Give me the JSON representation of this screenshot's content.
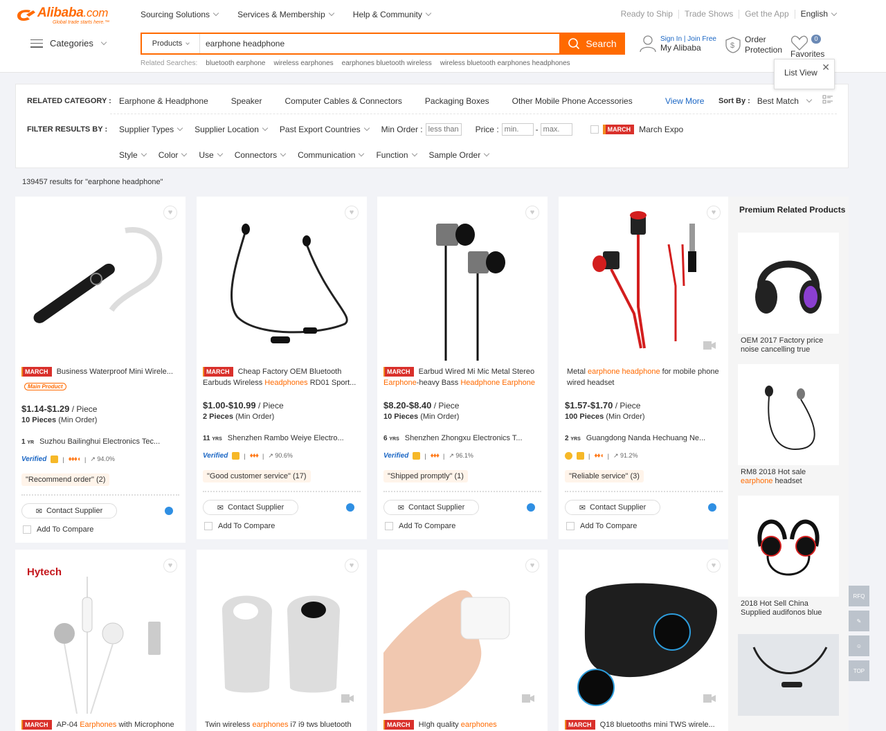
{
  "logo": {
    "brand": "Alibaba",
    "tld": ".com",
    "tagline": "Global trade starts here.™"
  },
  "topnav": [
    "Sourcing Solutions",
    "Services & Membership",
    "Help & Community"
  ],
  "topright": [
    "Ready to Ship",
    "Trade Shows",
    "Get the App",
    "English"
  ],
  "categories_label": "Categories",
  "search": {
    "type": "Products",
    "value": "earphone headphone",
    "button": "Search"
  },
  "related": {
    "label": "Related Searches:",
    "items": [
      "bluetooth earphone",
      "wireless earphones",
      "earphones bluetooth wireless",
      "wireless bluetooth earphones headphones"
    ]
  },
  "account": {
    "signin": "Sign In",
    "join": "Join Free",
    "my": "My Alibaba"
  },
  "order": {
    "line1": "Order",
    "line2": "Protection"
  },
  "favorites": {
    "label": "Favorites",
    "count": "0"
  },
  "listview": {
    "label": "List View"
  },
  "filter": {
    "related_label": "RELATED CATEGORY :",
    "related_items": [
      "Earphone & Headphone",
      "Speaker",
      "Computer Cables & Connectors",
      "Packaging Boxes",
      "Other Mobile Phone Accessories"
    ],
    "view_more": "View More",
    "sort_label": "Sort By :",
    "sort_value": "Best Match",
    "filter_label": "FILTER RESULTS BY :",
    "dropdowns1": [
      "Supplier Types",
      "Supplier Location",
      "Past Export Countries"
    ],
    "min_order_label": "Min Order :",
    "min_order_placeholder": "less than",
    "price_label": "Price :",
    "price_min": "min.",
    "price_max": "max.",
    "march_badge": "MARCH",
    "march_expo": "March Expo",
    "dropdowns2": [
      "Style",
      "Color",
      "Use",
      "Connectors",
      "Communication",
      "Function",
      "Sample Order"
    ]
  },
  "results_text": "139457 results for \"earphone headphone\"",
  "cards": [
    {
      "march": "MARCH",
      "title": "Business Waterproof Mini Wirele...",
      "main_product": "Main Product",
      "price": "$1.14-$1.29",
      "unit": "/ Piece",
      "moq": "10 Pieces",
      "moq_suffix": "(Min Order)",
      "yrs": "1",
      "supplier": "Suzhou Bailinghui Electronics Tec...",
      "verified": "Verified",
      "rate": "94.0%",
      "tag": "\"Recommend order\" (2)",
      "contact": "Contact Supplier",
      "compare": "Add To Compare"
    },
    {
      "march": "MARCH",
      "title_a": "Cheap Factory OEM Bluetooth Earbuds Wireless ",
      "title_hl": "Headphones",
      "title_b": " RD01 Sport...",
      "price": "$1.00-$10.99",
      "unit": "/ Piece",
      "moq": "2 Pieces",
      "moq_suffix": "(Min Order)",
      "yrs": "11",
      "supplier": "Shenzhen Rambo Weiye Electro...",
      "verified": "Verified",
      "rate": "90.6%",
      "tag": "\"Good customer service\" (17)",
      "contact": "Contact Supplier",
      "compare": "Add To Compare"
    },
    {
      "march": "MARCH",
      "title_a": "Earbud Wired Mi Mic Metal Stereo ",
      "title_hl1": "Earphone",
      "title_m": "-heavy Bass ",
      "title_hl2": "Headphone Earphone",
      "price": "$8.20-$8.40",
      "unit": "/ Piece",
      "moq": "10 Pieces",
      "moq_suffix": "(Min Order)",
      "yrs": "6",
      "supplier": "Shenzhen Zhongxu Electronics T...",
      "verified": "Verified",
      "rate": "96.1%",
      "tag": "\"Shipped promptly\" (1)",
      "contact": "Contact Supplier",
      "compare": "Add To Compare"
    },
    {
      "title_a": "Metal ",
      "title_hl": "earphone headphone",
      "title_b": " for mobile phone wired headset",
      "price": "$1.57-$1.70",
      "unit": "/ Piece",
      "moq": "100 Pieces",
      "moq_suffix": "(Min Order)",
      "yrs": "2",
      "supplier": "Guangdong Nanda Hechuang Ne...",
      "rate": "91.2%",
      "tag": "\"Reliable service\" (3)",
      "contact": "Contact Supplier",
      "compare": "Add To Compare"
    }
  ],
  "cards2": [
    {
      "march": "MARCH",
      "title_a": "AP-04 ",
      "title_hl": "Earphones",
      "title_b": " with Microphone",
      "brand": "Hytech"
    },
    {
      "title_a": "Twin wireless ",
      "title_hl": "earphones",
      "title_b": " i7 i9 tws bluetooth"
    },
    {
      "march": "MARCH",
      "title_a": "HIgh quality ",
      "title_hl": "earphones",
      "title_b": ""
    },
    {
      "march": "MARCH",
      "title_a": "Q18 bluetooths mini TWS wirele...",
      "title_hl": "",
      "title_b": ""
    }
  ],
  "premium": {
    "title": "Premium Related Products",
    "items": [
      {
        "text": "OEM 2017 Factory price noise cancelling true"
      },
      {
        "text_a": "RM8 2018 Hot sale ",
        "text_hl": "earphone",
        "text_b": " headset"
      },
      {
        "text": "2018 Hot Sell China Supplied audifonos blue"
      }
    ]
  },
  "float": [
    "RFQ",
    "TOP"
  ]
}
